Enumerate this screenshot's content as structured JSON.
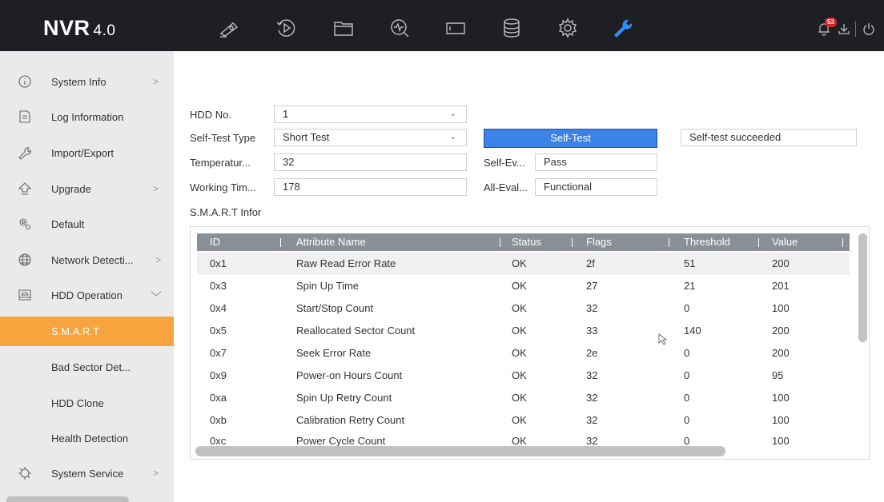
{
  "brand": {
    "name": "NVR",
    "version": "4.0"
  },
  "top_nav": [
    {
      "icon": "camera-live-icon"
    },
    {
      "icon": "playback-icon"
    },
    {
      "icon": "folder-icon"
    },
    {
      "icon": "search-icon"
    },
    {
      "icon": "monitor-icon"
    },
    {
      "icon": "storage-icon"
    },
    {
      "icon": "settings-icon"
    },
    {
      "icon": "maintenance-wrench-icon",
      "active": true
    }
  ],
  "top_right": {
    "alarm_count": "53",
    "icons": [
      "alarm-bell-icon",
      "download-icon",
      "power-icon"
    ]
  },
  "sidebar": {
    "items": [
      {
        "label": "System Info",
        "icon": "info-icon",
        "arrow": ">"
      },
      {
        "label": "Log Information",
        "icon": "log-icon"
      },
      {
        "label": "Import/Export",
        "icon": "import-export-icon"
      },
      {
        "label": "Upgrade",
        "icon": "upgrade-icon",
        "arrow": ">"
      },
      {
        "label": "Default",
        "icon": "default-icon"
      },
      {
        "label": "Network Detecti...",
        "icon": "network-icon",
        "arrow": ">"
      },
      {
        "label": "HDD Operation",
        "icon": "hdd-icon",
        "arrow": "v"
      },
      {
        "label": "S.M.A.R.T",
        "active": true
      },
      {
        "label": "Bad Sector Det..."
      },
      {
        "label": "HDD Clone"
      },
      {
        "label": "Health Detection"
      },
      {
        "label": "System Service",
        "icon": "service-icon",
        "arrow": ">"
      }
    ]
  },
  "form": {
    "hdd_no_label": "HDD No.",
    "hdd_no_value": "1",
    "self_test_type_label": "Self-Test Type",
    "self_test_type_value": "Short Test",
    "self_test_button": "Self-Test",
    "self_test_status": "Self-test succeeded",
    "temperature_label": "Temperatur...",
    "temperature_value": "32",
    "self_eval_label": "Self-Ev...",
    "self_eval_value": "Pass",
    "working_time_label": "Working Tim...",
    "working_time_value": "178",
    "all_eval_label": "All-Eval...",
    "all_eval_value": "Functional",
    "smart_info_label": "S.M.A.R.T Infor"
  },
  "table": {
    "headers": [
      "ID",
      "Attribute Name",
      "Status",
      "Flags",
      "Threshold",
      "Value"
    ],
    "rows": [
      [
        "0x1",
        "Raw Read Error Rate",
        "OK",
        "2f",
        "51",
        "200"
      ],
      [
        "0x3",
        "Spin Up Time",
        "OK",
        "27",
        "21",
        "201"
      ],
      [
        "0x4",
        "Start/Stop Count",
        "OK",
        "32",
        "0",
        "100"
      ],
      [
        "0x5",
        "Reallocated Sector Count",
        "OK",
        "33",
        "140",
        "200"
      ],
      [
        "0x7",
        "Seek Error Rate",
        "OK",
        "2e",
        "0",
        "200"
      ],
      [
        "0x9",
        "Power-on Hours Count",
        "OK",
        "32",
        "0",
        "95"
      ],
      [
        "0xa",
        "Spin Up Retry Count",
        "OK",
        "32",
        "0",
        "100"
      ],
      [
        "0xb",
        "Calibration Retry Count",
        "OK",
        "32",
        "0",
        "100"
      ],
      [
        "0xc",
        "Power Cycle Count",
        "OK",
        "32",
        "0",
        "100"
      ]
    ]
  },
  "colors": {
    "accent": "#f7a43e",
    "button": "#3c83e7",
    "topbar": "#1e1f23",
    "header": "#8b8f97",
    "wrench": "#2f8ef5"
  }
}
